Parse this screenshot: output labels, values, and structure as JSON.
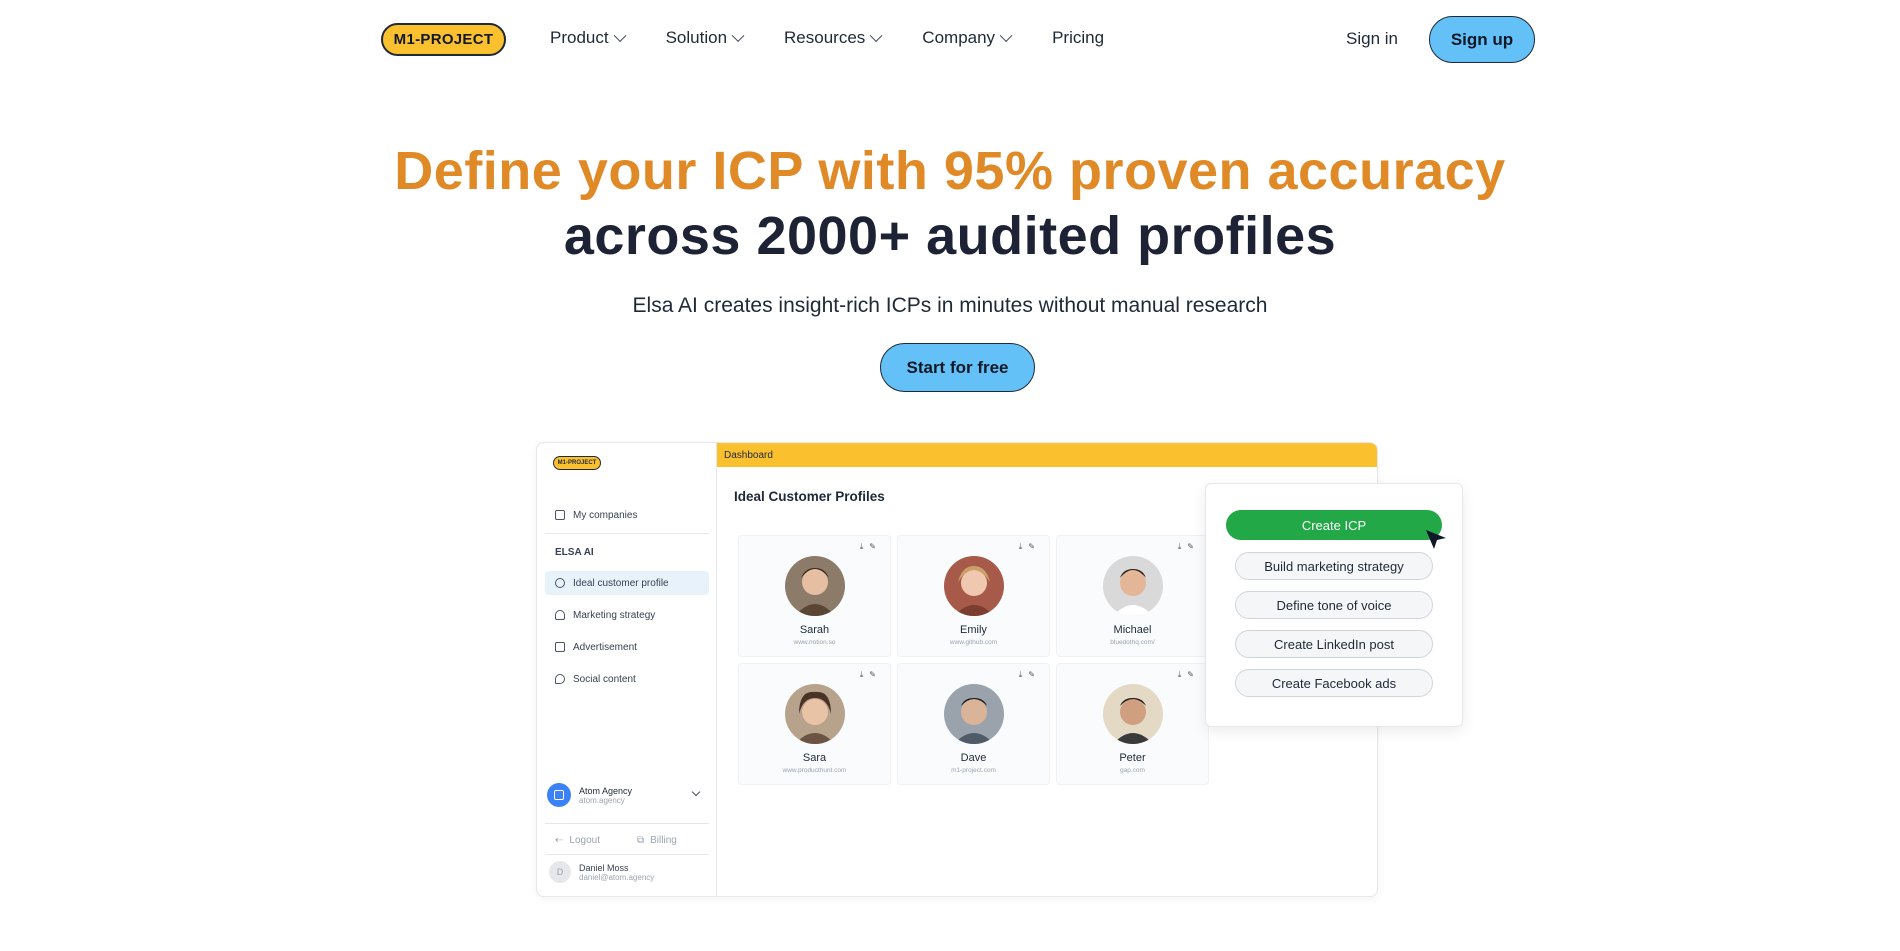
{
  "nav": {
    "logo": "M1-PROJECT",
    "links": [
      {
        "label": "Product",
        "dropdown": true
      },
      {
        "label": "Solution",
        "dropdown": true
      },
      {
        "label": "Resources",
        "dropdown": true
      },
      {
        "label": "Company",
        "dropdown": true
      },
      {
        "label": "Pricing",
        "dropdown": false
      }
    ],
    "signin": "Sign in",
    "signup": "Sign up"
  },
  "hero": {
    "line1": "Define your ICP with 95% proven accuracy",
    "line2": "across 2000+ audited profiles",
    "subtitle": "Elsa AI creates insight-rich ICPs in minutes without manual research",
    "cta": "Start for free"
  },
  "dashboard": {
    "logo": "M1-PROJECT",
    "topbar": "Dashboard",
    "title": "Ideal Customer Profiles",
    "sidebar": {
      "my_companies": "My companies",
      "section": "ELSA AI",
      "items": [
        "Ideal customer profile",
        "Marketing strategy",
        "Advertisement",
        "Social content"
      ],
      "agency_name": "Atom Agency",
      "agency_domain": "atom.agency",
      "logout": "Logout",
      "billing": "Billing",
      "user_initial": "D",
      "user_name": "Daniel Moss",
      "user_email": "daniel@atom.agency"
    },
    "profiles": [
      {
        "name": "Sarah",
        "url": "www.notion.so"
      },
      {
        "name": "Emily",
        "url": "www.github.com"
      },
      {
        "name": "Michael",
        "url": "bluedothq.com/"
      },
      {
        "name": "Sara",
        "url": "www.producthunt.com"
      },
      {
        "name": "Dave",
        "url": "m1-project.com"
      },
      {
        "name": "Peter",
        "url": "gap.com"
      }
    ],
    "popup": {
      "primary": "Create ICP",
      "options": [
        "Build marketing strategy",
        "Define tone of voice",
        "Create LinkedIn post",
        "Create Facebook ads"
      ]
    }
  },
  "colors": {
    "accent_orange": "#e08a27",
    "brand_yellow": "#fbc02d",
    "button_blue": "#64c1f7",
    "create_green": "#22a846"
  }
}
